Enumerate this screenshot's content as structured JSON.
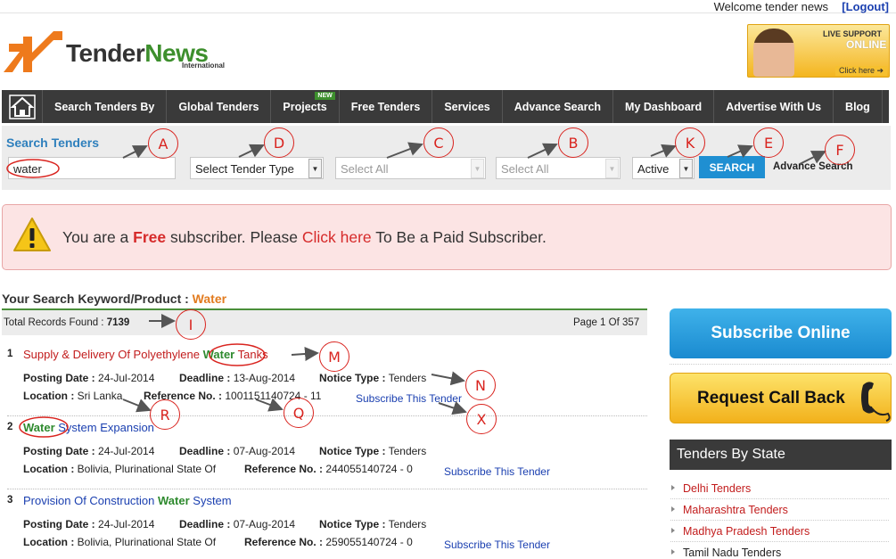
{
  "topbar": {
    "welcome": "Welcome tender news",
    "logout": "[Logout]"
  },
  "logo": {
    "brand_a": "Tender",
    "brand_b": "News",
    "sub": "International"
  },
  "live_support": {
    "line1": "LIVE SUPPORT",
    "line2": "ONLINE",
    "cta": "Click here ➔"
  },
  "nav": {
    "items": [
      {
        "label": "Search Tenders By"
      },
      {
        "label": "Global Tenders"
      },
      {
        "label": "Projects",
        "badge": "NEW"
      },
      {
        "label": "Free Tenders"
      },
      {
        "label": "Services"
      },
      {
        "label": "Advance Search"
      },
      {
        "label": "My Dashboard"
      },
      {
        "label": "Advertise With Us"
      },
      {
        "label": "Blog"
      }
    ]
  },
  "search": {
    "title": "Search Tenders",
    "keyword": "water",
    "tender_type": "Select Tender Type",
    "select1": "Select All",
    "select2": "Select All",
    "status": "Active",
    "button": "SEARCH",
    "advance": "Advance Search"
  },
  "alert": {
    "pre": "You are a ",
    "free": "Free",
    "mid": " subscriber. Please ",
    "link": "Click here",
    "post": " To Be a Paid Subscriber."
  },
  "results": {
    "keyword_label": "Your Search Keyword/Product :",
    "keyword_value": "Water",
    "total_label": "Total Records Found :",
    "total": "7139",
    "page": "Page 1 Of 357",
    "labels": {
      "posting": "Posting Date :",
      "deadline": "Deadline :",
      "notice": "Notice Type :",
      "location": "Location :",
      "reference": "Reference No. :",
      "subscribe": "Subscribe This Tender"
    },
    "items": [
      {
        "num": "1",
        "title_pre": "Supply & Delivery Of Polyethylene ",
        "title_kw": "Water",
        "title_post": " Tanks",
        "posting": "24-Jul-2014",
        "deadline": "13-Aug-2014",
        "notice": "Tenders",
        "location": "Sri Lanka",
        "reference": "1001151140724 - 11"
      },
      {
        "num": "2",
        "title_pre": "",
        "title_kw": "Water",
        "title_post": " System Expansion",
        "posting": "24-Jul-2014",
        "deadline": "07-Aug-2014",
        "notice": "Tenders",
        "location": "Bolivia, Plurinational State Of",
        "reference": "244055140724 - 0"
      },
      {
        "num": "3",
        "title_pre": "Provision Of Construction ",
        "title_kw": "Water",
        "title_post": " System",
        "posting": "24-Jul-2014",
        "deadline": "07-Aug-2014",
        "notice": "Tenders",
        "location": "Bolivia, Plurinational State Of",
        "reference": "259055140724 - 0"
      }
    ]
  },
  "sidebar": {
    "subscribe": "Subscribe Online",
    "callback": "Request Call Back",
    "states_title": "Tenders By State",
    "states": [
      "Delhi Tenders",
      "Maharashtra Tenders",
      "Madhya Pradesh Tenders",
      "Tamil Nadu Tenders"
    ]
  },
  "annotations": [
    "A",
    "D",
    "C",
    "B",
    "K",
    "E",
    "F",
    "I",
    "M",
    "N",
    "R",
    "Q",
    "X"
  ],
  "colors": {
    "nav_bg": "#3a3a3a",
    "accent_blue": "#2f80bd",
    "brand_green": "#3d8f2d",
    "alert_bg": "#fce4e4",
    "annotation_red": "#d9241f"
  }
}
